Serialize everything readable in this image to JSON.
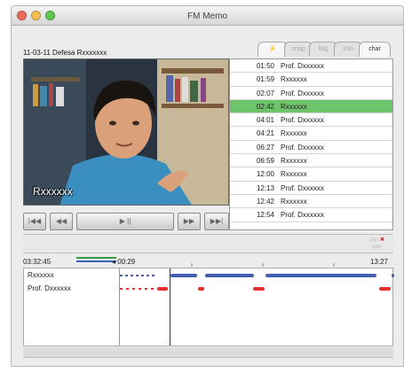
{
  "window": {
    "title": "FM Memo"
  },
  "session": {
    "label": "11-03-11  Defesa Rxxxxxxx"
  },
  "video": {
    "speaker_name": "Rxxxxxx"
  },
  "transport": {
    "buttons": [
      {
        "name": "skip-start-button",
        "glyph": "|◀◀"
      },
      {
        "name": "rewind-button",
        "glyph": "◀◀"
      },
      {
        "name": "play-pause-button",
        "glyph": "▶ ||"
      },
      {
        "name": "fast-forward-button",
        "glyph": "▶▶"
      },
      {
        "name": "skip-end-button",
        "glyph": "▶▶|"
      }
    ]
  },
  "tabs": [
    {
      "label": "⚡",
      "active": true
    },
    {
      "label": "snap",
      "active": false
    },
    {
      "label": "flag",
      "active": false
    },
    {
      "label": "info",
      "active": false
    },
    {
      "label": "char",
      "active": true
    }
  ],
  "turns": [
    {
      "time": "01:50",
      "speaker": "Prof. Dxxxxxx",
      "selected": false
    },
    {
      "time": "01:59",
      "speaker": "Rxxxxxx",
      "selected": false
    },
    {
      "time": "02:07",
      "speaker": "Prof. Dxxxxxx",
      "selected": false
    },
    {
      "time": "02:42",
      "speaker": "Rxxxxxx",
      "selected": true
    },
    {
      "time": "04:01",
      "speaker": "Prof. Dxxxxxx",
      "selected": false
    },
    {
      "time": "04:21",
      "speaker": "Rxxxxxx",
      "selected": false
    },
    {
      "time": "06:27",
      "speaker": "Prof. Dxxxxxx",
      "selected": false
    },
    {
      "time": "06:59",
      "speaker": "Rxxxxxx",
      "selected": false
    },
    {
      "time": "12:00",
      "speaker": "Rxxxxxx",
      "selected": false
    },
    {
      "time": "12:13",
      "speaker": "Prof. Dxxxxxx",
      "selected": false
    },
    {
      "time": "12:42",
      "speaker": "Rxxxxxx",
      "selected": false
    },
    {
      "time": "12:54",
      "speaker": "Prof. Dxxxxxx",
      "selected": false
    }
  ],
  "strip": {
    "label_top": "ann",
    "label_bottom": "spkr"
  },
  "timeline": {
    "start": "03:32:45",
    "cursor": "◂ 00:29",
    "end": "13:27",
    "lanes": [
      "Rxxxxxx",
      "Prof. Dxxxxxx"
    ]
  },
  "colors": {
    "selection": "#6ec46b",
    "speaker_a": "#3f5fb0",
    "speaker_b": "#e53030"
  }
}
